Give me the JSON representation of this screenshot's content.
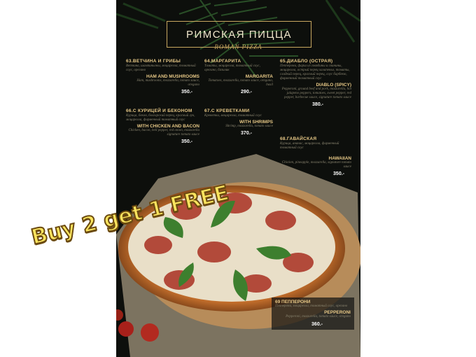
{
  "menu": {
    "title_ru": "РИМСКАЯ ПИЦЦА",
    "title_en": "ROMAN PIZZA",
    "items": [
      {
        "ru": "63.ВЕТЧИНА И ГРИБЫ",
        "ru_desc": "Ветчина, шампиньоны, моцарелла, томатный соус, орегано",
        "en": "HAM AND MUSHROOMS",
        "en_desc": "Ham, mushrooms, mozzarella, tomato sauce, oregano",
        "price": "350.-"
      },
      {
        "ru": "64.МАРГАРИТА",
        "ru_desc": "Томаты, моцарелла, томатный соус, орегано, базилик",
        "en": "MARGARITA",
        "en_desc": "Tomatoes, mozzarella, tomato sauce, oregano, basil",
        "price": "290.-"
      },
      {
        "ru": "65.ДИАБЛО (ОСТРАЯ)",
        "ru_desc": "Пепперони, фарш из говядины и свинины, моцарелла, острый перец халапеньо, томаты, сладкий перец, красный перец, соус барбекю, фирменный томатный соус",
        "en": "DIABLO (SPICY)",
        "en_desc": "Pepperoni, ground beef and pork, mozzarella, hot jalapeno peppers, tomatoes, sweet pepper, red pepper, barbecue sauce, signature tomato sauce",
        "price": "380.-"
      },
      {
        "ru": "66.С КУРИЦЕЙ И БЕКОНОМ",
        "ru_desc": "Курица, бекон, болгарский перец, красный лук, моцарелла, фирменный томатный соус",
        "en": "WITH CHICKEN AND BACON",
        "en_desc": "Chicken, bacon, bell pepper, red onion, mozzarella signature tomato sauce",
        "price": "350.-"
      },
      {
        "ru": "67.С КРЕВЕТКАМИ",
        "ru_desc": "Креветки, моцарелла, томатный соус",
        "en": "WITH SHRIMPS",
        "en_desc": "Shrimp, mozzarella, tomato sauce",
        "price": "370.-"
      },
      {
        "ru": "68.ГАВАЙСКАЯ",
        "ru_desc": "Курица, ананас, моцарелла, фирменный томатный соус",
        "en": "HAWAIIAN",
        "en_desc": "Chicken, pineapple, mozzarella, signature tomato sauce",
        "price": "350.-"
      },
      {
        "ru": "69 ПЕППЕРОНИ",
        "ru_desc": "Пепперони, моцарелла, томатный соус, орегано",
        "en": "PEPPERONI",
        "en_desc": "Pepperoni, mozzarella, tomato sauce, oregano",
        "price": "360.-"
      }
    ]
  },
  "promo": {
    "text": "Buy 2 get 1 FREE"
  },
  "colors": {
    "background": "#0d0f0c",
    "gold": "#e8c987",
    "promo_fill": "#fbe45e",
    "promo_outline": "#6b4a10"
  },
  "icons": [
    "palm-leaf-decoration",
    "pizza-image",
    "basil-leaf",
    "cherry-tomato"
  ]
}
